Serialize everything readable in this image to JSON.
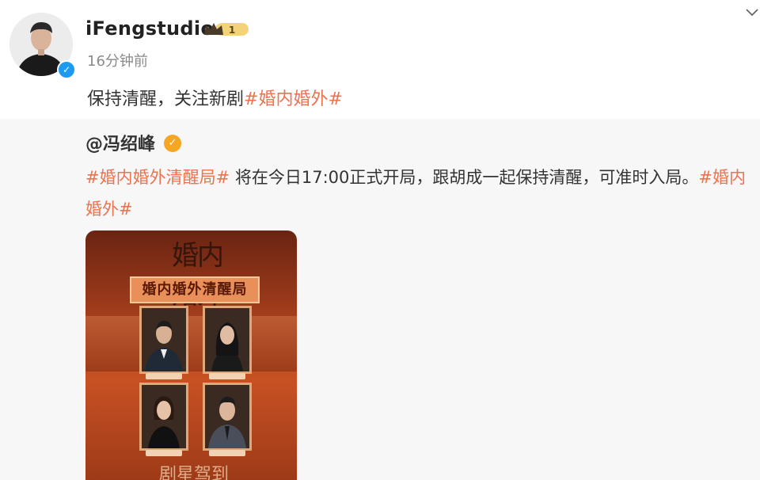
{
  "post": {
    "username": "iFengstudio",
    "level_badge": "1",
    "time": "16分钟前",
    "text_plain": "保持清醒，关注新剧",
    "text_tag": "#婚内婚外#"
  },
  "repost": {
    "author": "@冯绍峰",
    "text_tag_start": "#婚内婚外清醒局#",
    "text_body": " 将在今日17:00正式开局，跟胡成一起保持清醒，可准时入局。",
    "text_tag_end": "#婚内婚外#"
  },
  "poster": {
    "title": "婚内婚外",
    "banner": "婚内婚外清醒局",
    "bottom_text": "剧星驾到"
  },
  "icons": {
    "verified": "verified-check-icon",
    "crown": "crown-level-icon",
    "dropdown": "chevron-down-icon"
  },
  "colors": {
    "tag": "#eb7350",
    "verified_blue": "#1d9bf0",
    "verified_gold": "#f5a623"
  }
}
